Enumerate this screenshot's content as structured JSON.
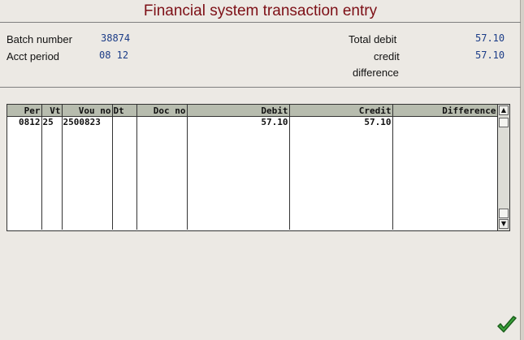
{
  "title": "Financial system transaction entry",
  "header": {
    "batch_label": "Batch number",
    "batch_value": "38874",
    "period_label": "Acct period",
    "period_value": "08 12",
    "total_debit_label": "Total debit",
    "total_debit_value": "57.10",
    "credit_label": "credit",
    "credit_value": "57.10",
    "difference_label": "difference"
  },
  "grid": {
    "columns": [
      "Per",
      "Vt",
      "Vou no",
      "Dt",
      "Doc no",
      "Debit",
      "Credit",
      "Difference"
    ],
    "rows": [
      {
        "per": "0812",
        "vt": "25",
        "vou_no": "2500823",
        "dt": "",
        "doc_no": "",
        "debit": "57.10",
        "credit": "57.10",
        "difference": ""
      }
    ]
  },
  "scroll": {
    "up_icon": "up-arrow-icon",
    "down_icon": "down-arrow-icon"
  },
  "colors": {
    "title": "#7d0f16",
    "value": "#1b3c87",
    "header_bg": "#b7bcae",
    "confirm": "#2e8b2e"
  }
}
